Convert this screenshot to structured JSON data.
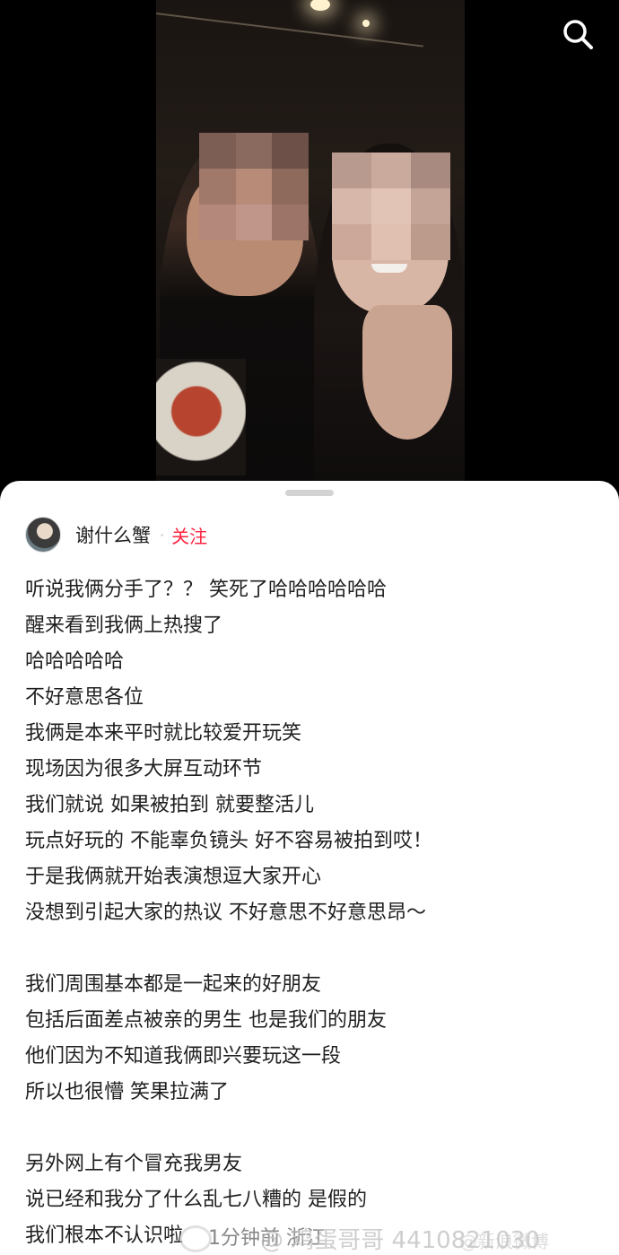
{
  "post": {
    "author_name": "谢什么蟹",
    "separator": "·",
    "follow_label": "关注",
    "lines": [
      "听说我俩分手了？？  笑死了哈哈哈哈哈哈",
      "醒来看到我俩上热搜了",
      "哈哈哈哈哈",
      "不好意思各位",
      "我俩是本来平时就比较爱开玩笑",
      "现场因为很多大屏互动环节",
      "我们就说 如果被拍到 就要整活儿",
      "玩点好玩的 不能辜负镜头 好不容易被拍到哎！",
      "于是我俩就开始表演想逗大家开心",
      "没想到引起大家的热议 不好意思不好意思昂～",
      "",
      "我们周围基本都是一起来的好朋友",
      "包括后面差点被亲的男生 也是我们的朋友",
      "他们因为不知道我俩即兴要玩这一段",
      "所以也很懵 笑果拉满了",
      "",
      "另外网上有个冒充我男友",
      "说已经和我分了什么乱七八糟的 是假的",
      "我们根本不认识啦"
    ],
    "footer_meta": "1分钟前  浙江"
  },
  "watermark": {
    "text": "@ 鸡蛋哥哥 4410821030",
    "right_text": "@新浪微博"
  },
  "icons": {
    "search": "search-icon"
  }
}
